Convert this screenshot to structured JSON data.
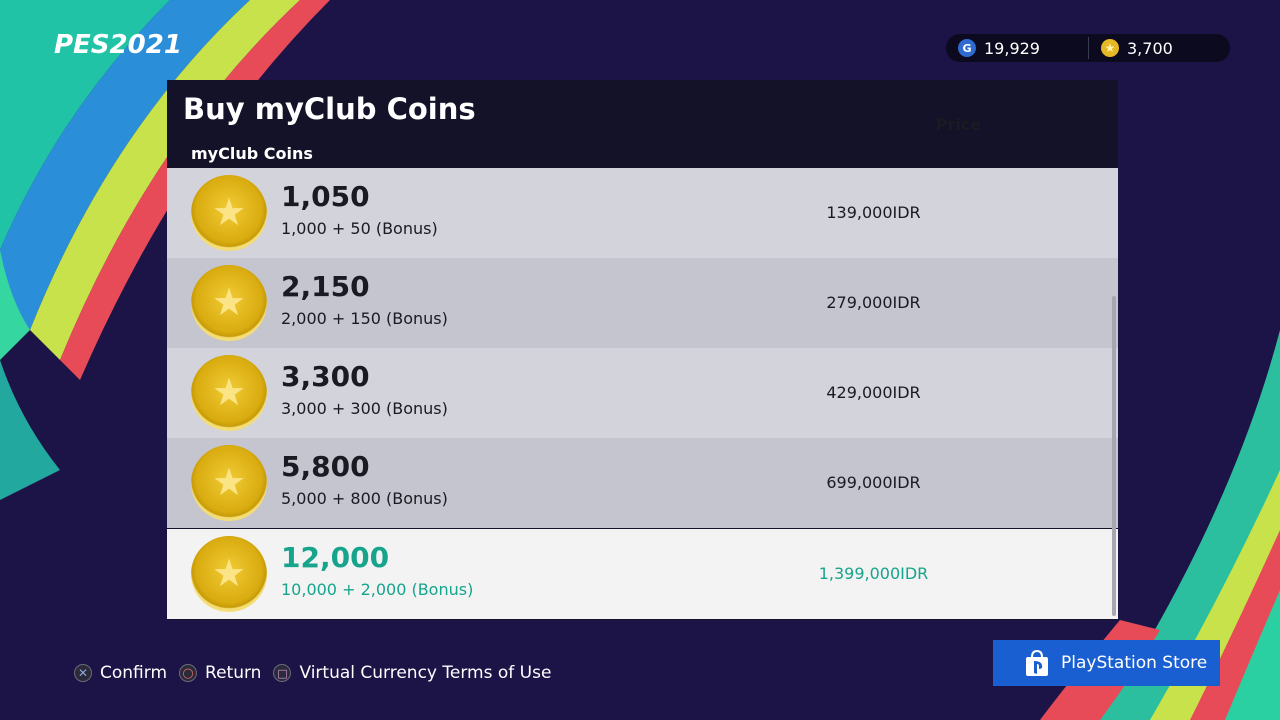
{
  "header": {
    "logo_text": "PES2021",
    "gp_icon": "G",
    "gp_value": "19,929",
    "coin_icon": "star-icon",
    "coins_value": "3,700"
  },
  "panel": {
    "title": "Buy myClub Coins",
    "col_coins": "myClub Coins",
    "col_price": "Price",
    "items": [
      {
        "amount": "1,050",
        "detail": "1,000 + 50 (Bonus)",
        "price": "139,000IDR"
      },
      {
        "amount": "2,150",
        "detail": "2,000 + 150 (Bonus)",
        "price": "279,000IDR"
      },
      {
        "amount": "3,300",
        "detail": "3,000 + 300 (Bonus)",
        "price": "429,000IDR"
      },
      {
        "amount": "5,800",
        "detail": "5,000 + 800 (Bonus)",
        "price": "699,000IDR"
      },
      {
        "amount": "12,000",
        "detail": "10,000 + 2,000 (Bonus)",
        "price": "1,399,000IDR"
      }
    ]
  },
  "footer": {
    "confirm": "Confirm",
    "return": "Return",
    "terms": "Virtual Currency Terms of Use"
  },
  "store": {
    "label": "PlayStation Store"
  },
  "colors": {
    "background": "#1c1447",
    "selected_text": "#17a48d",
    "store_blue": "#1a5fd1",
    "coin_gold": "#e7b826"
  }
}
